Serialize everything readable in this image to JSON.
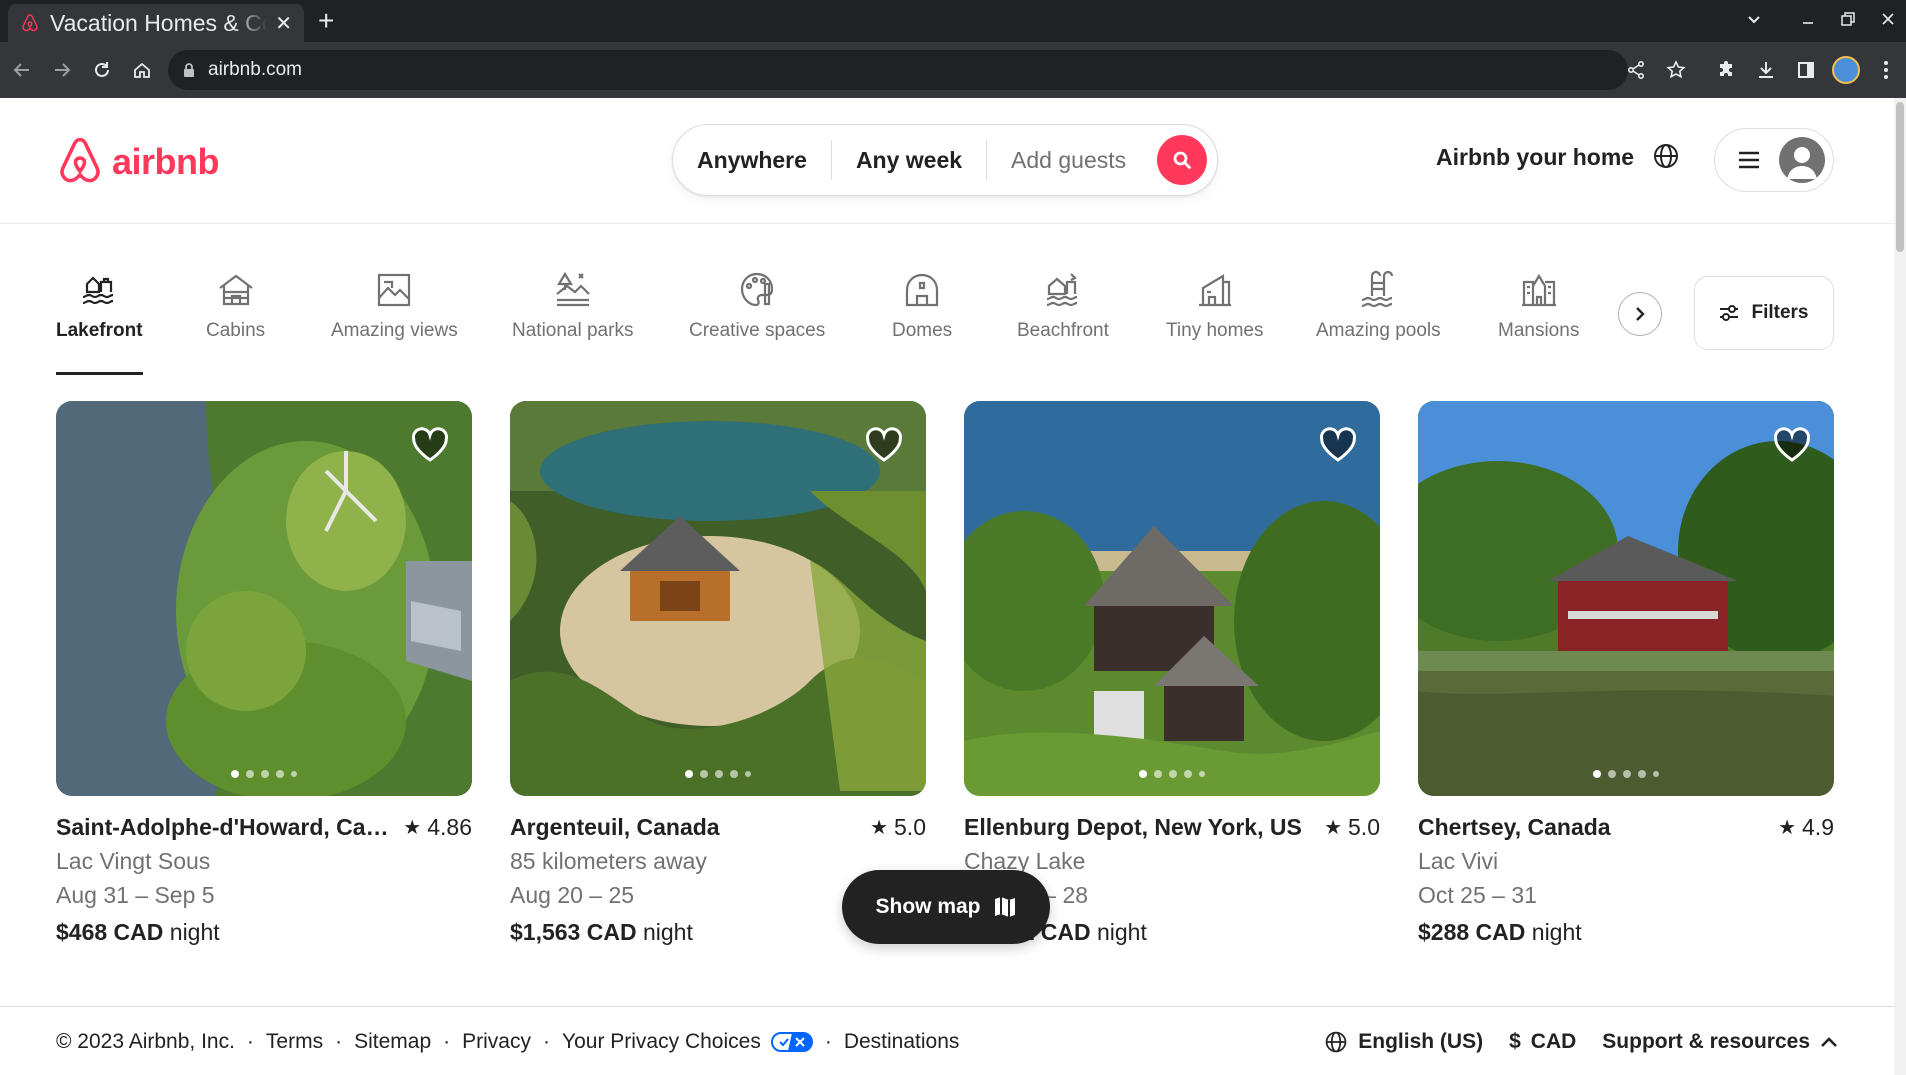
{
  "browser": {
    "tab_title": "Vacation Homes & Condo Rentals",
    "url": "airbnb.com"
  },
  "header": {
    "logo_text": "airbnb",
    "search": {
      "where": "Anywhere",
      "when": "Any week",
      "who": "Add guests"
    },
    "host_link": "Airbnb your home"
  },
  "categories": [
    {
      "label": "Lakefront",
      "icon": "lakefront-icon",
      "active": true
    },
    {
      "label": "Cabins",
      "icon": "cabin-icon"
    },
    {
      "label": "Amazing views",
      "icon": "views-icon"
    },
    {
      "label": "National parks",
      "icon": "park-icon"
    },
    {
      "label": "Creative spaces",
      "icon": "palette-icon"
    },
    {
      "label": "Domes",
      "icon": "dome-icon"
    },
    {
      "label": "Beachfront",
      "icon": "beach-icon"
    },
    {
      "label": "Tiny homes",
      "icon": "tiny-home-icon"
    },
    {
      "label": "Amazing pools",
      "icon": "pool-icon"
    },
    {
      "label": "Mansions",
      "icon": "mansion-icon"
    }
  ],
  "filters_label": "Filters",
  "listings": [
    {
      "location": "Saint-Adolphe-d'Howard, Canada",
      "rating": "4.86",
      "subtitle": "Lac Vingt Sous",
      "dates": "Aug 31 – Sep 5",
      "price": "$468 CAD",
      "unit": "night"
    },
    {
      "location": "Argenteuil, Canada",
      "rating": "5.0",
      "subtitle": "85 kilometers away",
      "dates": "Aug 20 – 25",
      "price": "$1,563 CAD",
      "unit": "night"
    },
    {
      "location": "Ellenburg Depot, New York, US",
      "rating": "5.0",
      "subtitle": "Chazy Lake",
      "dates": "Aug 23 – 28",
      "price": "$1,331 CAD",
      "unit": "night"
    },
    {
      "location": "Chertsey, Canada",
      "rating": "4.9",
      "subtitle": "Lac Vivi",
      "dates": "Oct 25 – 31",
      "price": "$288 CAD",
      "unit": "night"
    }
  ],
  "show_map_label": "Show map",
  "footer": {
    "copyright": "© 2023 Airbnb, Inc.",
    "links": [
      "Terms",
      "Sitemap",
      "Privacy",
      "Your Privacy Choices",
      "Destinations"
    ],
    "language": "English (US)",
    "currency_symbol": "$",
    "currency": "CAD",
    "support": "Support & resources"
  },
  "colors": {
    "brand": "#FF385C",
    "text": "#222222",
    "muted": "#717171"
  }
}
